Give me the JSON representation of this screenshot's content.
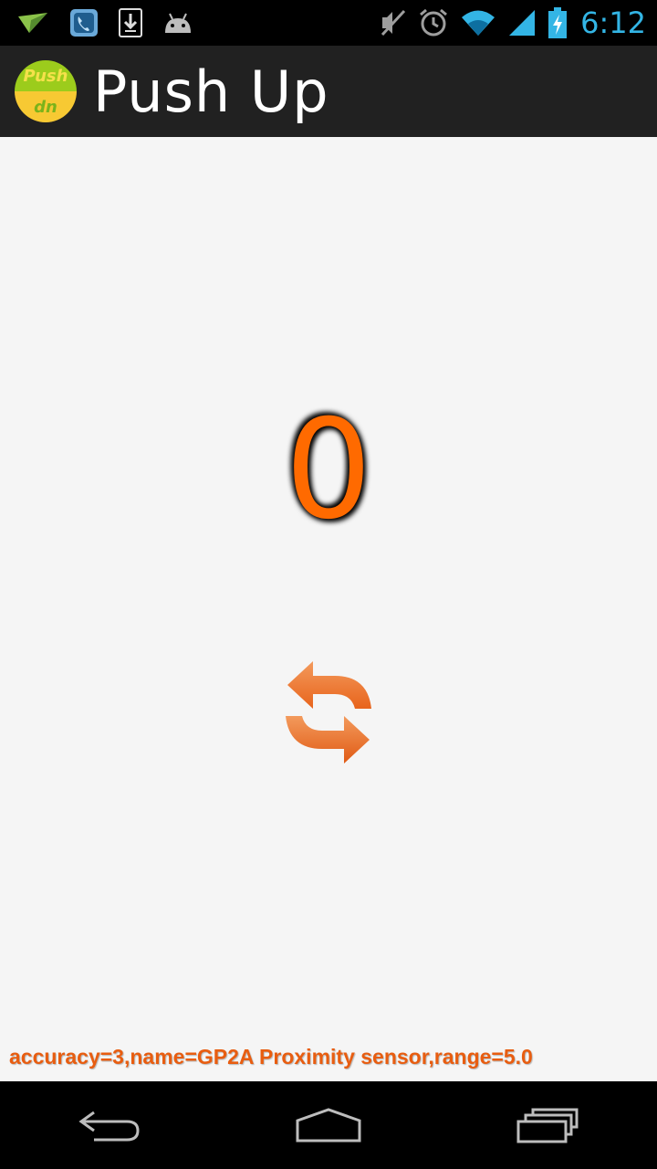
{
  "status_bar": {
    "time": "6:12",
    "icons_left": [
      "paper-plane-icon",
      "phone-app-icon",
      "download-icon",
      "android-icon"
    ],
    "icons_right": [
      "mute-icon",
      "alarm-icon",
      "wifi-icon",
      "signal-icon",
      "battery-icon"
    ],
    "accent_color": "#33b5e5"
  },
  "action_bar": {
    "logo_top_text": "Push",
    "logo_bottom_text": "dn",
    "title": "Push Up"
  },
  "main": {
    "count": "0",
    "count_color": "#ff6a00",
    "reset_icon": "refresh-arrows-icon",
    "sensor_info": "accuracy=3,name=GP2A Proximity sensor,range=5.0",
    "background": "#f5f5f5"
  },
  "nav_bar": {
    "buttons": [
      "back-icon",
      "home-icon",
      "recent-apps-icon"
    ]
  }
}
